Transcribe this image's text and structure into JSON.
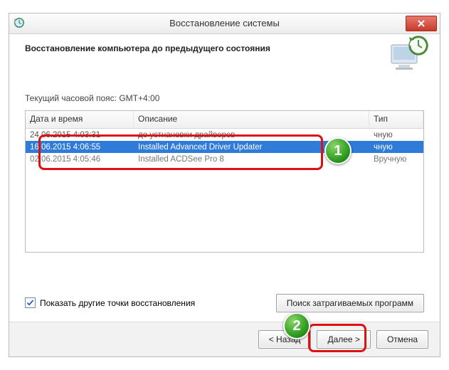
{
  "window": {
    "title": "Восстановление системы"
  },
  "header": {
    "subtitle": "Восстановление компьютера до предыдущего состояния"
  },
  "timezone_label": "Текущий часовой пояс: GMT+4:00",
  "table": {
    "columns": {
      "date": "Дата и время",
      "desc": "Описание",
      "type": "Тип"
    },
    "rows": [
      {
        "date": "24.06.2015 4:03:31",
        "desc": "до устнановки драйверов",
        "type": "чную",
        "selected": false
      },
      {
        "date": "16.06.2015 4:06:55",
        "desc": "Installed Advanced Driver Updater",
        "type": "чную",
        "selected": true
      },
      {
        "date": "02.06.2015 4:05:46",
        "desc": "Installed ACDSee Pro 8",
        "type": "Вручную",
        "selected": false
      }
    ]
  },
  "checkbox": {
    "checked": true,
    "label": "Показать другие точки восстановления"
  },
  "buttons": {
    "affected": "Поиск затрагиваемых программ",
    "back": "< Назад",
    "next": "Далее >",
    "cancel": "Отмена"
  },
  "annotations": {
    "badge1": "1",
    "badge2": "2"
  }
}
